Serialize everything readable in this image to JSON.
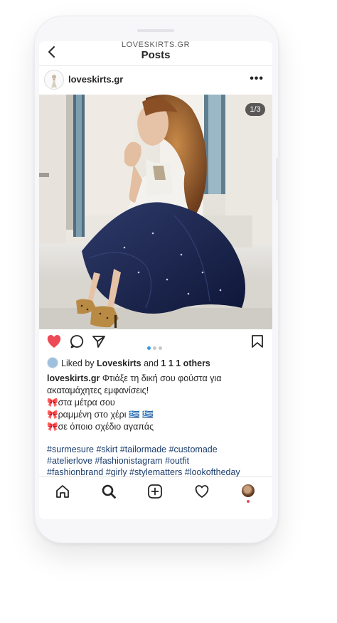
{
  "watermark": "LOVESKIRTS.GR",
  "nav": {
    "title": "Posts"
  },
  "post": {
    "username": "loveskirts.gr",
    "more": "•••",
    "image_counter": "1/3",
    "likes": {
      "prefix": "Liked by",
      "user": "Loveskirts",
      "joiner": "and",
      "count": "1 1 1 others"
    },
    "caption": {
      "user": "loveskirts.gr",
      "lines": [
        "Φτιάξε τη δική σου φούστα για",
        "ακαταμάχητες εμφανίσεις!",
        "🎀στα μέτρα σου",
        "🎀ραμμένη στο χέρι 🇬🇷 🇬🇷",
        "🎀σε όποιο σχέδιο αγαπάς"
      ]
    },
    "hashtags": [
      "#surmesure #skirt #tailormade #customade",
      "#atelierlove #fashionistagram #outfit",
      "#fashionbrand #girly #stylematters  #lookoftheday"
    ]
  },
  "colors": {
    "like": "#ed4956",
    "hashtag": "#1b3d6e",
    "dot_active": "#3897f0"
  },
  "icons": [
    "back-chevron-icon",
    "heart-icon",
    "comment-icon",
    "share-icon",
    "bookmark-icon",
    "home-icon",
    "search-icon",
    "add-icon",
    "activity-heart-icon",
    "profile-avatar-icon"
  ]
}
